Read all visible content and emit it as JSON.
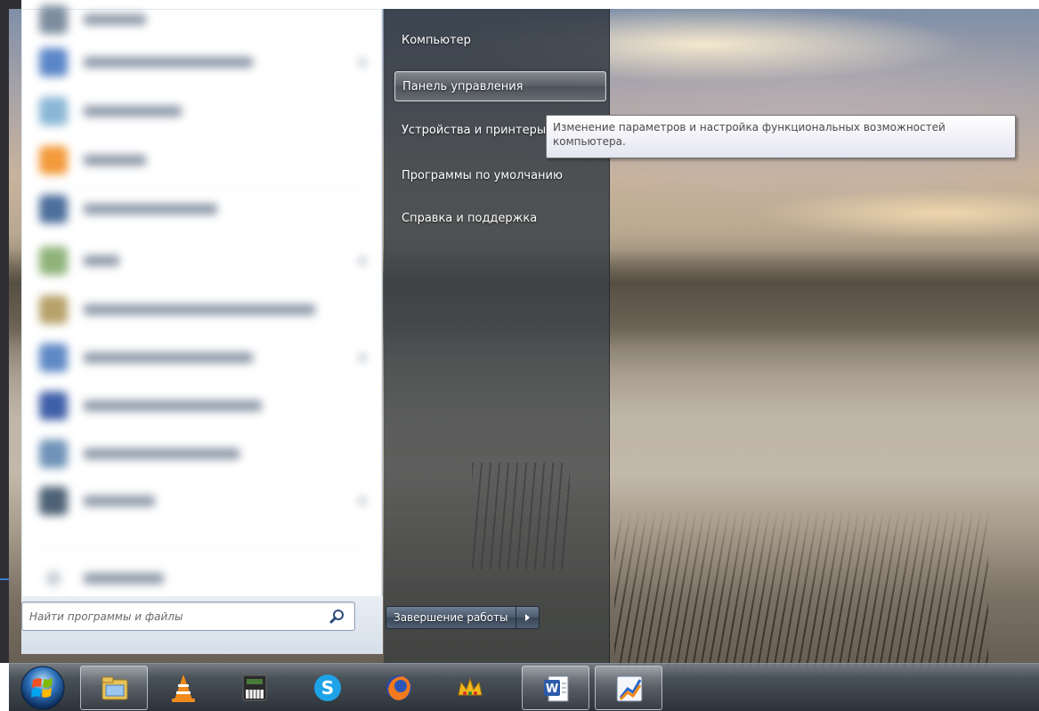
{
  "right_pane": {
    "items": [
      {
        "label": "Компьютер"
      },
      {
        "label": "Панель управления"
      },
      {
        "label": "Устройства и принтеры"
      },
      {
        "label": "Программы по умолчанию"
      },
      {
        "label": "Справка и поддержка"
      }
    ],
    "hovered_index": 1
  },
  "tooltip": {
    "line1": "Изменение параметров и настройка функциональных возможностей",
    "line2": "компьютера."
  },
  "search": {
    "placeholder": "Найти программы и файлы"
  },
  "shutdown": {
    "label": "Завершение работы"
  },
  "taskbar": {
    "items": [
      {
        "icon": "windows-start-orb-icon"
      },
      {
        "icon": "windows-explorer-icon",
        "active": true
      },
      {
        "icon": "vlc-player-icon"
      },
      {
        "icon": "piano-keyboard-icon"
      },
      {
        "icon": "skype-icon"
      },
      {
        "icon": "firefox-icon"
      },
      {
        "icon": "crown-app-icon"
      },
      {
        "icon": "microsoft-word-icon",
        "active": true
      },
      {
        "icon": "chart-viewer-icon",
        "active": true
      }
    ]
  },
  "colors": {
    "tooltip_text": "#4c4c4c",
    "menu_text": "#ffffff",
    "accent_blue": "#3a7bd5"
  }
}
